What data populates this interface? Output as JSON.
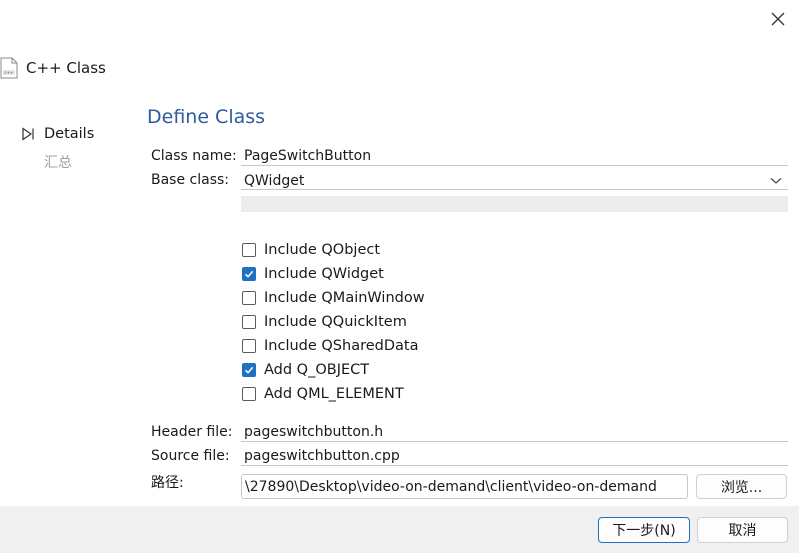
{
  "window": {
    "close_glyph": "✕"
  },
  "wizard": {
    "title": "C++ Class",
    "icon": "cpp-file-icon"
  },
  "steps": [
    {
      "label": "Details",
      "active": true
    },
    {
      "label": "汇总",
      "active": false
    }
  ],
  "form": {
    "section_title": "Define Class",
    "class_name_label": "Class name:",
    "class_name_value": "PageSwitchButton",
    "base_class_label": "Base class:",
    "base_class_value": "QWidget",
    "checkboxes": [
      {
        "label": "Include QObject",
        "checked": false
      },
      {
        "label": "Include QWidget",
        "checked": true
      },
      {
        "label": "Include QMainWindow",
        "checked": false
      },
      {
        "label": "Include QQuickItem",
        "checked": false
      },
      {
        "label": "Include QSharedData",
        "checked": false
      },
      {
        "label": "Add Q_OBJECT",
        "checked": true
      },
      {
        "label": "Add QML_ELEMENT",
        "checked": false
      }
    ],
    "header_file_label": "Header file:",
    "header_file_value": "pageswitchbutton.h",
    "source_file_label": "Source file:",
    "source_file_value": "pageswitchbutton.cpp",
    "path_label": "路径:",
    "path_value": "\\27890\\Desktop\\video-on-demand\\client\\video-on-demand",
    "browse_label": "浏览..."
  },
  "footer": {
    "next_label": "下一步(N)",
    "cancel_label": "取消"
  },
  "colors": {
    "accent": "#1f6fc5",
    "section_title": "#2e5b9b",
    "footer_bg": "#f0f0f0"
  }
}
